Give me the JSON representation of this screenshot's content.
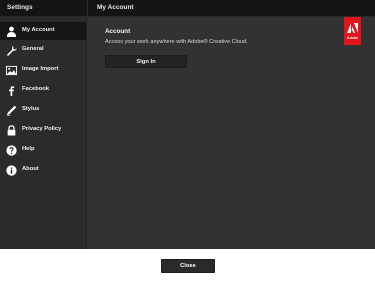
{
  "header": {
    "left_title": "Settings",
    "right_title": "My Account"
  },
  "sidebar": {
    "items": [
      {
        "label": "My Account",
        "icon": "user-icon",
        "active": true
      },
      {
        "label": "General",
        "icon": "wrench-icon"
      },
      {
        "label": "Image Import",
        "icon": "image-icon"
      },
      {
        "label": "Facebook",
        "icon": "facebook-icon"
      },
      {
        "label": "Stylus",
        "icon": "stylus-icon"
      },
      {
        "label": "Privacy Policy",
        "icon": "lock-icon"
      },
      {
        "label": "Help",
        "icon": "help-icon"
      },
      {
        "label": "About",
        "icon": "info-icon"
      }
    ]
  },
  "content": {
    "section_title": "Account",
    "description": "Access your work anywhere with Adobe® Creative Cloud.",
    "signin_label": "Sign In",
    "badge_word": "Adobe"
  },
  "footer": {
    "close_label": "Close"
  },
  "colors": {
    "accent": "#e3121b",
    "header_bg": "#141414",
    "sidebar_bg": "#2b2b2b",
    "content_bg": "#323232"
  }
}
